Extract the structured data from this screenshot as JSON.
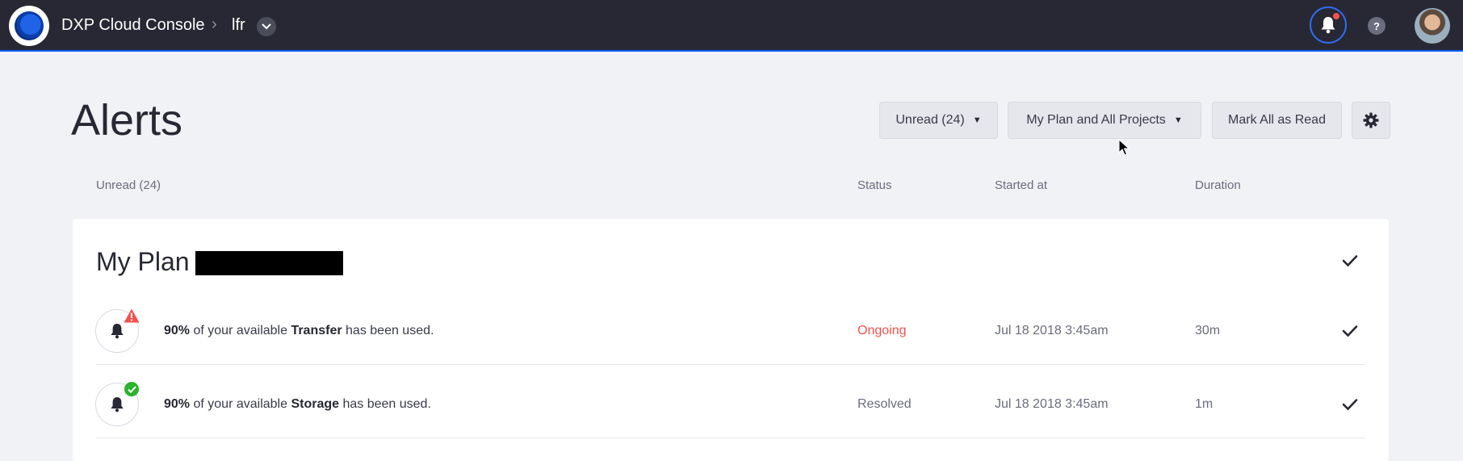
{
  "topbar": {
    "app_title": "DXP Cloud Console",
    "breadcrumb_separator": "›",
    "project": "lfr",
    "help_label": "?"
  },
  "page": {
    "title": "Alerts",
    "filter_unread": "Unread (24)",
    "filter_scope": "My Plan and All Projects",
    "mark_all_read": "Mark All as Read"
  },
  "table": {
    "columns": {
      "name": "Unread (24)",
      "status": "Status",
      "started": "Started at",
      "duration": "Duration"
    }
  },
  "group": {
    "title": "My Plan"
  },
  "alerts": [
    {
      "percent": "90%",
      "pre": " of your available ",
      "resource": "Transfer",
      "post": " has been used.",
      "status": "Ongoing",
      "started": "Jul 18 2018 3:45am",
      "duration": "30m",
      "badge": "warning-icon"
    },
    {
      "percent": "90%",
      "pre": " of your available ",
      "resource": "Storage",
      "post": " has been used.",
      "status": "Resolved",
      "started": "Jul 18 2018 3:45am",
      "duration": "1m",
      "badge": "check-circle-icon"
    }
  ],
  "colors": {
    "topbar": "#272833",
    "accent": "#0b5fff",
    "ongoing": "#f5504c",
    "resolved_badge": "#2cb22c",
    "page_bg": "#f1f2f5"
  }
}
